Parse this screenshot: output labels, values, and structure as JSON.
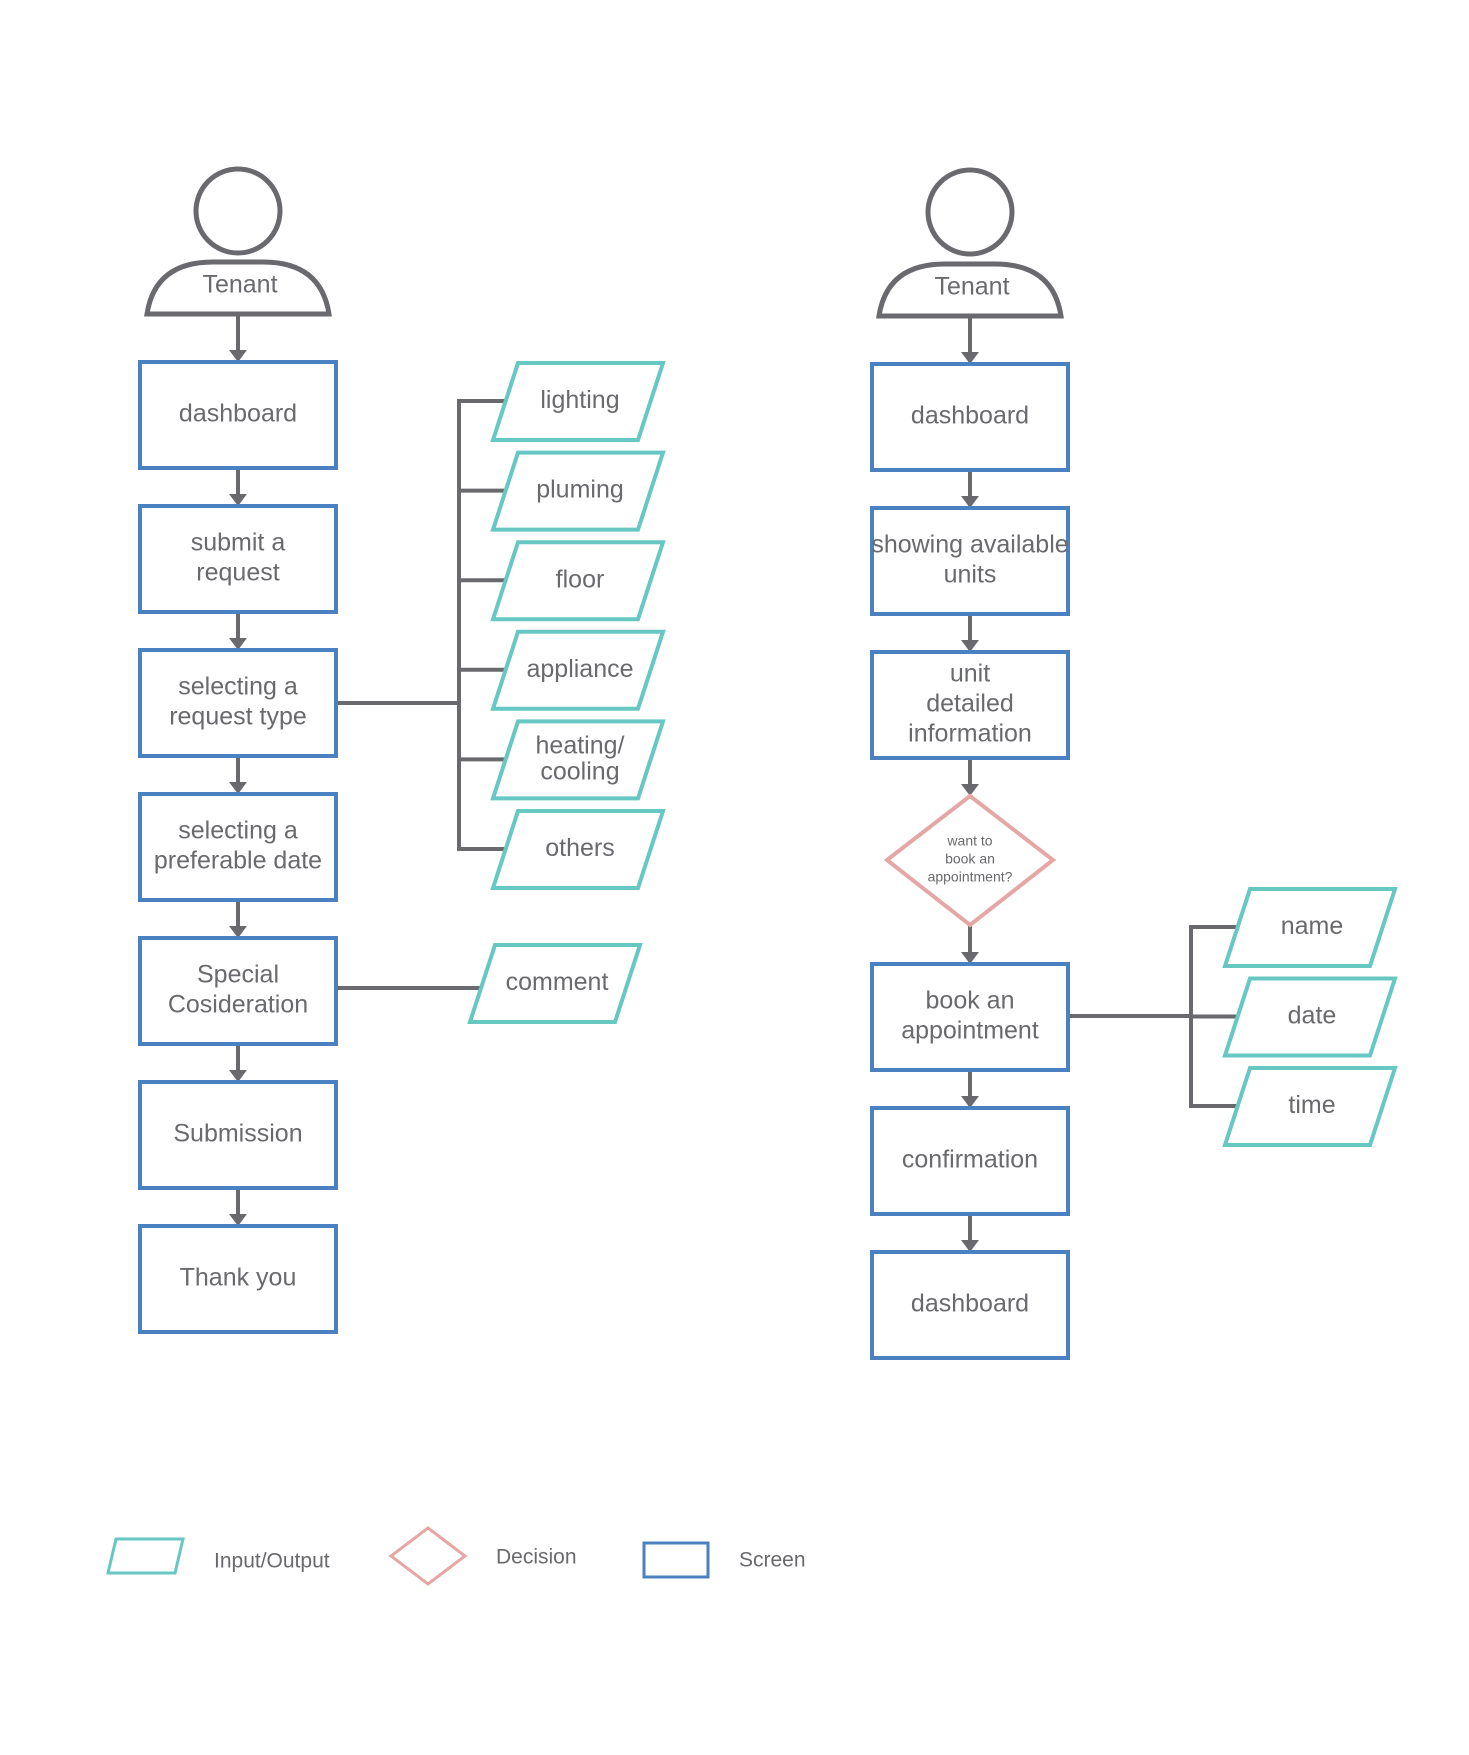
{
  "colors": {
    "screen": "#4a81c1",
    "input_output": "#67c7c2",
    "decision": "#e5a7a6",
    "connector": "#6a6a6e",
    "text": "#6a6a6e"
  },
  "flow_left": {
    "actor": "Tenant",
    "steps": [
      {
        "id": "dashboard",
        "lines": [
          "dashboard"
        ]
      },
      {
        "id": "submit-request",
        "lines": [
          "submit a",
          "request"
        ]
      },
      {
        "id": "select-request-type",
        "lines": [
          "selecting a",
          "request type"
        ]
      },
      {
        "id": "select-date",
        "lines": [
          "selecting a",
          "preferable date"
        ]
      },
      {
        "id": "special-consideration",
        "lines": [
          "Special",
          "Cosideration"
        ]
      },
      {
        "id": "submission",
        "lines": [
          "Submission"
        ]
      },
      {
        "id": "thank-you",
        "lines": [
          "Thank you"
        ]
      }
    ],
    "request_types": [
      {
        "lines": [
          "lighting"
        ]
      },
      {
        "lines": [
          "pluming"
        ]
      },
      {
        "lines": [
          "floor"
        ]
      },
      {
        "lines": [
          "appliance"
        ]
      },
      {
        "lines": [
          "heating/",
          "cooling"
        ]
      },
      {
        "lines": [
          "others"
        ]
      }
    ],
    "special_inputs": [
      {
        "lines": [
          "comment"
        ]
      }
    ]
  },
  "flow_right": {
    "actor": "Tenant",
    "steps_before": [
      {
        "id": "dashboard",
        "lines": [
          "dashboard"
        ]
      },
      {
        "id": "available-units",
        "lines": [
          "showing available",
          "units"
        ]
      },
      {
        "id": "unit-details",
        "lines": [
          "unit",
          "detailed",
          "information"
        ]
      }
    ],
    "decision": {
      "lines": [
        "want to",
        "book an",
        "appointment?"
      ]
    },
    "steps_after": [
      {
        "id": "book-appointment",
        "lines": [
          "book an",
          "appointment"
        ]
      },
      {
        "id": "confirmation",
        "lines": [
          "confirmation"
        ]
      },
      {
        "id": "dashboard-end",
        "lines": [
          "dashboard"
        ]
      }
    ],
    "booking_inputs": [
      {
        "lines": [
          "name"
        ]
      },
      {
        "lines": [
          "date"
        ]
      },
      {
        "lines": [
          "time"
        ]
      }
    ]
  },
  "legend": {
    "input_output": "Input/Output",
    "decision": "Decision",
    "screen": "Screen"
  }
}
